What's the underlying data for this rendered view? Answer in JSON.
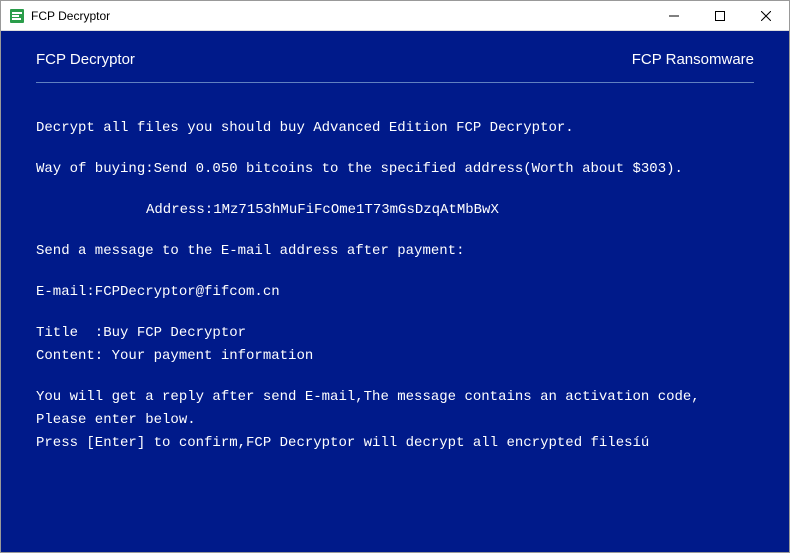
{
  "titlebar": {
    "title": "FCP Decryptor"
  },
  "header": {
    "left": "FCP Decryptor",
    "right": "FCP Ransomware"
  },
  "body": {
    "line1": "Decrypt all files you should buy Advanced Edition FCP Decryptor.",
    "line2": "Way of buying:Send 0.050 bitcoins to the specified address(Worth about $303).",
    "address": "Address:1Mz7153hMuFiFcOme1T73mGsDzqAtMbBwX",
    "line3": "Send a message to the E-mail address after payment:",
    "email": "E-mail:FCPDecryptor@fifcom.cn",
    "title_line": "Title  :Buy FCP Decryptor",
    "content_line": "Content: Your payment information",
    "line4": "You will get a reply after send E-mail,The message contains an activation code,",
    "line5": "Please enter below.",
    "line6": "Press [Enter] to confirm,FCP Decryptor will decrypt all encrypted filesíú"
  }
}
